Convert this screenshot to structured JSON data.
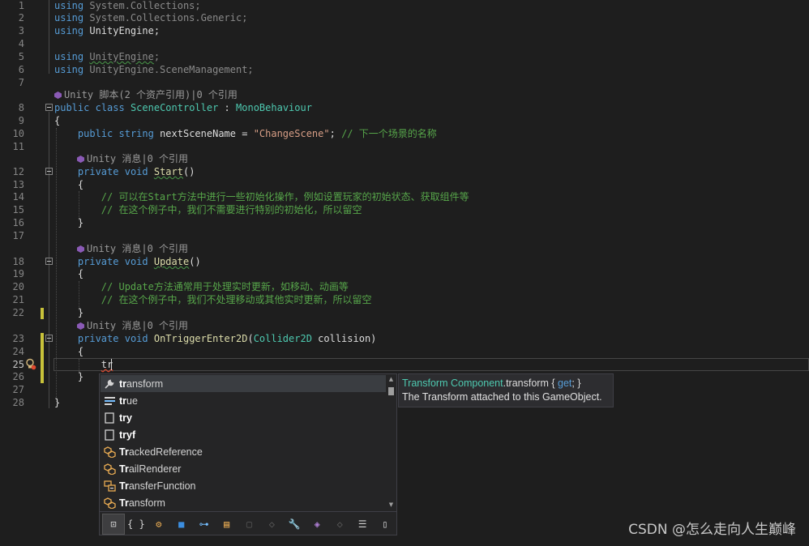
{
  "editor": {
    "line_numbers": [
      "1",
      "2",
      "3",
      "4",
      "5",
      "6",
      "7",
      "8",
      "9",
      "10",
      "11",
      "12",
      "13",
      "14",
      "15",
      "16",
      "17",
      "18",
      "19",
      "20",
      "21",
      "22",
      "23",
      "24",
      "25",
      "26",
      "27",
      "28"
    ],
    "current_line": "25",
    "codelens": {
      "class": "Unity 脚本(2 个资产引用)|0 个引用",
      "start": "Unity 消息|0 个引用",
      "update": "Unity 消息|0 个引用",
      "trigger": "Unity 消息|0 个引用"
    },
    "code": {
      "l1_kw": "using",
      "l1_rest": " System.Collections;",
      "l2_kw": "using",
      "l2_rest": " System.Collections.Generic;",
      "l3_kw": "using",
      "l3_rest": " UnityEngine;",
      "l5_kw": "using",
      "l5_ns": "UnityEngine",
      "l5_semi": ";",
      "l6_kw": "using",
      "l6_rest": " UnityEngine.SceneManagement;",
      "l8_kw1": "public",
      "l8_kw2": "class",
      "l8_name": "SceneController",
      "l8_colon": " : ",
      "l8_base": "MonoBehaviour",
      "l9": "{",
      "l10_kw1": "public",
      "l10_kw2": "string",
      "l10_name": " nextSceneName = ",
      "l10_str": "\"ChangeScene\"",
      "l10_semi": "; ",
      "l10_cm": "// 下一个场景的名称",
      "l12_kw1": "private",
      "l12_kw2": "void",
      "l12_fn": "Start",
      "l12_rest": "()",
      "l13": "{",
      "l14_cm": "// 可以在Start方法中进行一些初始化操作，例如设置玩家的初始状态、获取组件等",
      "l15_cm": "// 在这个例子中，我们不需要进行特别的初始化，所以留空",
      "l16": "}",
      "l18_kw1": "private",
      "l18_kw2": "void",
      "l18_fn": "Update",
      "l18_rest": "()",
      "l19": "{",
      "l20_cm": "// Update方法通常用于处理实时更新，如移动、动画等",
      "l21_cm": "// 在这个例子中，我们不处理移动或其他实时更新，所以留空",
      "l22": "}",
      "l23_kw1": "private",
      "l23_kw2": "void",
      "l23_fn": "OnTriggerEnter2D",
      "l23_p1": "(",
      "l23_type": "Collider2D",
      "l23_p2": " collision)",
      "l24": "{",
      "l25": "tr",
      "l26": "}",
      "l28": "}"
    }
  },
  "completion": {
    "items": [
      {
        "match": "tr",
        "rest": "ansform",
        "icon": "wrench-icon"
      },
      {
        "match": "tr",
        "rest": "ue",
        "icon": "keyword-icon"
      },
      {
        "match": "try",
        "rest": "",
        "icon": "snippet-icon"
      },
      {
        "match": "tryf",
        "rest": "",
        "icon": "snippet-icon"
      },
      {
        "match": "Tr",
        "rest": "ackedReference",
        "icon": "class-icon"
      },
      {
        "match": "Tr",
        "rest": "ailRenderer",
        "icon": "class-icon"
      },
      {
        "match": "Tr",
        "rest": "ansferFunction",
        "icon": "enum-icon"
      },
      {
        "match": "Tr",
        "rest": "ansform",
        "icon": "class-icon"
      }
    ],
    "filter_buttons": [
      {
        "name": "filter-expand-icon",
        "glyph": "⊡"
      },
      {
        "name": "filter-namespace-icon",
        "glyph": "{ }"
      },
      {
        "name": "filter-class-icon",
        "glyph": "⚙"
      },
      {
        "name": "filter-struct-icon",
        "glyph": "■"
      },
      {
        "name": "filter-interface-icon",
        "glyph": "⊶"
      },
      {
        "name": "filter-enum-icon",
        "glyph": "▤"
      },
      {
        "name": "filter-delegate-icon",
        "glyph": "▢"
      },
      {
        "name": "filter-module-icon",
        "glyph": "◇"
      },
      {
        "name": "filter-property-icon",
        "glyph": "🔧"
      },
      {
        "name": "filter-method-icon",
        "glyph": "◈"
      },
      {
        "name": "filter-field-icon",
        "glyph": "◇"
      },
      {
        "name": "filter-keyword-icon",
        "glyph": "☰"
      },
      {
        "name": "filter-snippet-icon",
        "glyph": "▯"
      }
    ]
  },
  "quickinfo": {
    "type": "Transform",
    "component": "Component",
    "member": ".transform",
    "brace_open": " { ",
    "get": "get",
    "brace_close": "; }",
    "description": "The Transform attached to this GameObject."
  },
  "watermark": "CSDN @怎么走向人生巅峰",
  "colors": {
    "background": "#1e1e1e",
    "keyword": "#569cd6",
    "type": "#4ec9b0",
    "string": "#d69d85",
    "comment": "#57a64a",
    "method": "#dcdcaa"
  }
}
